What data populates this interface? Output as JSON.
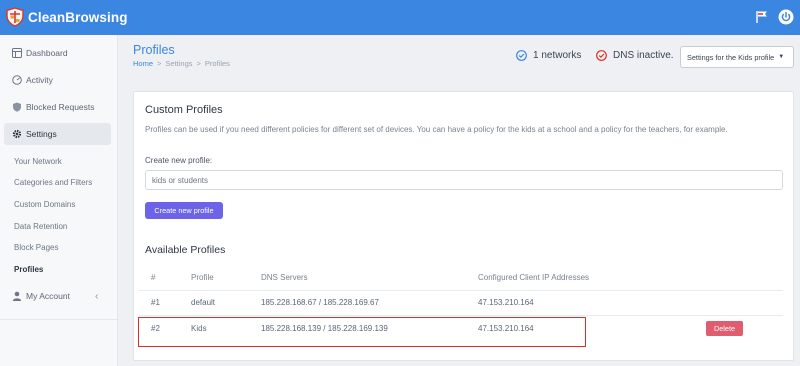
{
  "app": {
    "name": "CleanBrowsing"
  },
  "sidebar": {
    "main_items": [
      {
        "label": "Dashboard",
        "icon": "dashboard-icon"
      },
      {
        "label": "Activity",
        "icon": "activity-icon"
      },
      {
        "label": "Blocked Requests",
        "icon": "shield-icon"
      },
      {
        "label": "Settings",
        "icon": "gear-icon"
      }
    ],
    "sub_items": [
      "Your Network",
      "Categories and Filters",
      "Custom Domains",
      "Data Retention",
      "Block Pages",
      "Profiles"
    ],
    "account_label": "My Account"
  },
  "page": {
    "title": "Profiles",
    "breadcrumb": [
      "Home",
      ">",
      "Settings",
      ">",
      "Profiles"
    ]
  },
  "status": {
    "networks": "1 networks",
    "dns": "DNS inactive.",
    "networks_color": "#3a86e0",
    "dns_color": "#d93025"
  },
  "profile_select": {
    "value": "Settings for the Kids profile"
  },
  "custom_profiles": {
    "title": "Custom Profiles",
    "description": "Profiles can be used if you need different policies for different set of devices. You can have a policy for the kids at a school and a policy for the teachers, for example.",
    "input_label": "Create new profile:",
    "input_placeholder": "kids or students",
    "create_button": "Create new profile"
  },
  "available_profiles": {
    "title": "Available Profiles",
    "headers": [
      "#",
      "Profile",
      "DNS Servers",
      "Configured Client IP Addresses"
    ],
    "rows": [
      {
        "num": "#1",
        "profile": "default",
        "dns": "185.228.168.67 / 185.228.169.67",
        "ip": "47.153.210.164"
      },
      {
        "num": "#2",
        "profile": "Kids",
        "dns": "185.228.168.139 / 185.228.169.139",
        "ip": "47.153.210.164",
        "action": "Delete"
      }
    ]
  },
  "colors": {
    "header": "#3a86e0",
    "primary_button": "#6c63e8",
    "delete_button": "#e05d6f",
    "highlight": "#d93025"
  }
}
